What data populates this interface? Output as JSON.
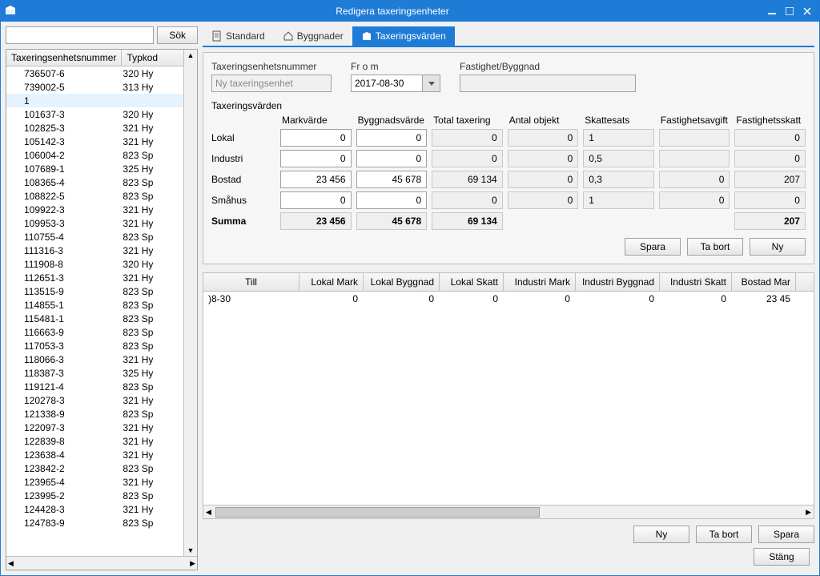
{
  "window": {
    "title": "Redigera taxeringsenheter"
  },
  "search": {
    "placeholder": "",
    "button": "Sök"
  },
  "leftGrid": {
    "headers": [
      "Taxeringsenhetsnummer",
      "Typkod"
    ],
    "rows": [
      {
        "num": "736507-6",
        "typ": "320 Hy"
      },
      {
        "num": "739002-5",
        "typ": "313 Hy"
      },
      {
        "num": "1",
        "typ": ""
      },
      {
        "num": "101637-3",
        "typ": "320 Hy"
      },
      {
        "num": "102825-3",
        "typ": "321 Hy"
      },
      {
        "num": "105142-3",
        "typ": "321 Hy"
      },
      {
        "num": "106004-2",
        "typ": "823 Sp"
      },
      {
        "num": "107689-1",
        "typ": "325 Hy"
      },
      {
        "num": "108365-4",
        "typ": "823 Sp"
      },
      {
        "num": "108822-5",
        "typ": "823 Sp"
      },
      {
        "num": "109922-3",
        "typ": "321 Hy"
      },
      {
        "num": "109953-3",
        "typ": "321 Hy"
      },
      {
        "num": "110755-4",
        "typ": "823 Sp"
      },
      {
        "num": "111316-3",
        "typ": "321 Hy"
      },
      {
        "num": "111908-8",
        "typ": "320 Hy"
      },
      {
        "num": "112651-3",
        "typ": "321 Hy"
      },
      {
        "num": "113515-9",
        "typ": "823 Sp"
      },
      {
        "num": "114855-1",
        "typ": "823 Sp"
      },
      {
        "num": "115481-1",
        "typ": "823 Sp"
      },
      {
        "num": "116663-9",
        "typ": "823 Sp"
      },
      {
        "num": "117053-3",
        "typ": "823 Sp"
      },
      {
        "num": "118066-3",
        "typ": "321 Hy"
      },
      {
        "num": "118387-3",
        "typ": "325 Hy"
      },
      {
        "num": "119121-4",
        "typ": "823 Sp"
      },
      {
        "num": "120278-3",
        "typ": "321 Hy"
      },
      {
        "num": "121338-9",
        "typ": "823 Sp"
      },
      {
        "num": "122097-3",
        "typ": "321 Hy"
      },
      {
        "num": "122839-8",
        "typ": "321 Hy"
      },
      {
        "num": "123638-4",
        "typ": "321 Hy"
      },
      {
        "num": "123842-2",
        "typ": "823 Sp"
      },
      {
        "num": "123965-4",
        "typ": "321 Hy"
      },
      {
        "num": "123995-2",
        "typ": "823 Sp"
      },
      {
        "num": "124428-3",
        "typ": "321 Hy"
      },
      {
        "num": "124783-9",
        "typ": "823 Sp"
      }
    ],
    "selectedIndex": 2
  },
  "tabs": [
    {
      "label": "Standard",
      "icon": "document-icon"
    },
    {
      "label": "Byggnader",
      "icon": "home-icon"
    },
    {
      "label": "Taxeringsvärden",
      "icon": "box-icon"
    }
  ],
  "activeTab": 2,
  "form": {
    "taxLabel": "Taxeringsenhetsnummer",
    "taxPlaceholder": "Ny taxeringsenhet",
    "fromLabel": "Fr o m",
    "fromValue": "2017-08-30",
    "fastighetLabel": "Fastighet/Byggnad",
    "fastighetValue": "",
    "sectionLabel": "Taxeringsvärden",
    "cols": [
      "Markvärde",
      "Byggnadsvärde",
      "Total taxering",
      "Antal objekt",
      "Skattesats",
      "Fastighetsavgift",
      "Fastighetsskatt"
    ],
    "rows": [
      {
        "label": "Lokal",
        "mark": "0",
        "bygg": "0",
        "total": "0",
        "antal": "0",
        "skatte": "1",
        "avgift": "",
        "skatt": "0"
      },
      {
        "label": "Industri",
        "mark": "0",
        "bygg": "0",
        "total": "0",
        "antal": "0",
        "skatte": "0,5",
        "avgift": "",
        "skatt": "0"
      },
      {
        "label": "Bostad",
        "mark": "23 456",
        "bygg": "45 678",
        "total": "69 134",
        "antal": "0",
        "skatte": "0,3",
        "avgift": "0",
        "skatt": "207"
      },
      {
        "label": "Småhus",
        "mark": "0",
        "bygg": "0",
        "total": "0",
        "antal": "0",
        "skatte": "1",
        "avgift": "0",
        "skatt": "0"
      }
    ],
    "sum": {
      "label": "Summa",
      "mark": "23 456",
      "bygg": "45 678",
      "total": "69 134",
      "skatt": "207"
    }
  },
  "panelButtons": {
    "save": "Spara",
    "delete": "Ta bort",
    "new": "Ny"
  },
  "historyGrid": {
    "headers": [
      "Till",
      "Lokal Mark",
      "Lokal Byggnad",
      "Lokal Skatt",
      "Industri Mark",
      "Industri Byggnad",
      "Industri Skatt",
      "Bostad Mar"
    ],
    "row": {
      "till": ")8-30",
      "lm": "0",
      "lb": "0",
      "ls": "0",
      "im": "0",
      "ib": "0",
      "is": "0",
      "bm": "23 45"
    }
  },
  "footerButtons": {
    "new": "Ny",
    "delete": "Ta bort",
    "save": "Spara",
    "close": "Stäng"
  }
}
